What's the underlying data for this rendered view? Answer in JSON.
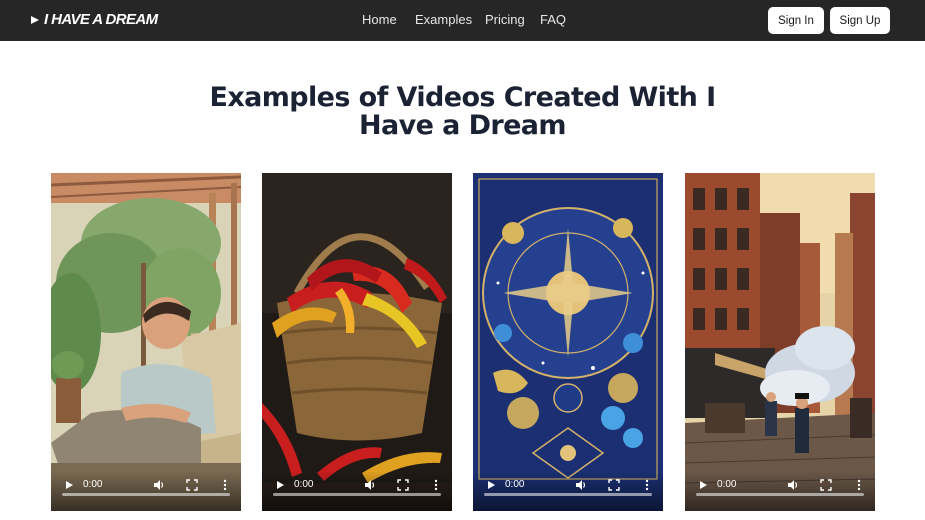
{
  "header": {
    "logo_text": "I HAVE A DREAM",
    "nav": [
      "Home",
      "Examples",
      "Pricing",
      "FAQ"
    ],
    "sign_in": "Sign In",
    "sign_up": "Sign Up"
  },
  "main": {
    "title": "Examples of Videos Created With I Have a Dream",
    "videos": [
      {
        "subject": "man relaxing in lounge chair",
        "time": "0:00",
        "progress": 0
      },
      {
        "subject": "basket of chili peppers",
        "time": "0:00",
        "progress": 0
      },
      {
        "subject": "zodiac astrology chart",
        "time": "0:00",
        "progress": 0
      },
      {
        "subject": "old city street with people",
        "time": "0:00",
        "progress": 0
      }
    ]
  },
  "icons": {
    "logo": "play-triangle-icon",
    "play": "play-icon",
    "volume": "volume-icon",
    "fullscreen": "fullscreen-icon",
    "more": "more-vertical-icon"
  },
  "colors": {
    "navbar": "#262626",
    "title": "#1b2233",
    "button_bg": "#ffffff"
  }
}
